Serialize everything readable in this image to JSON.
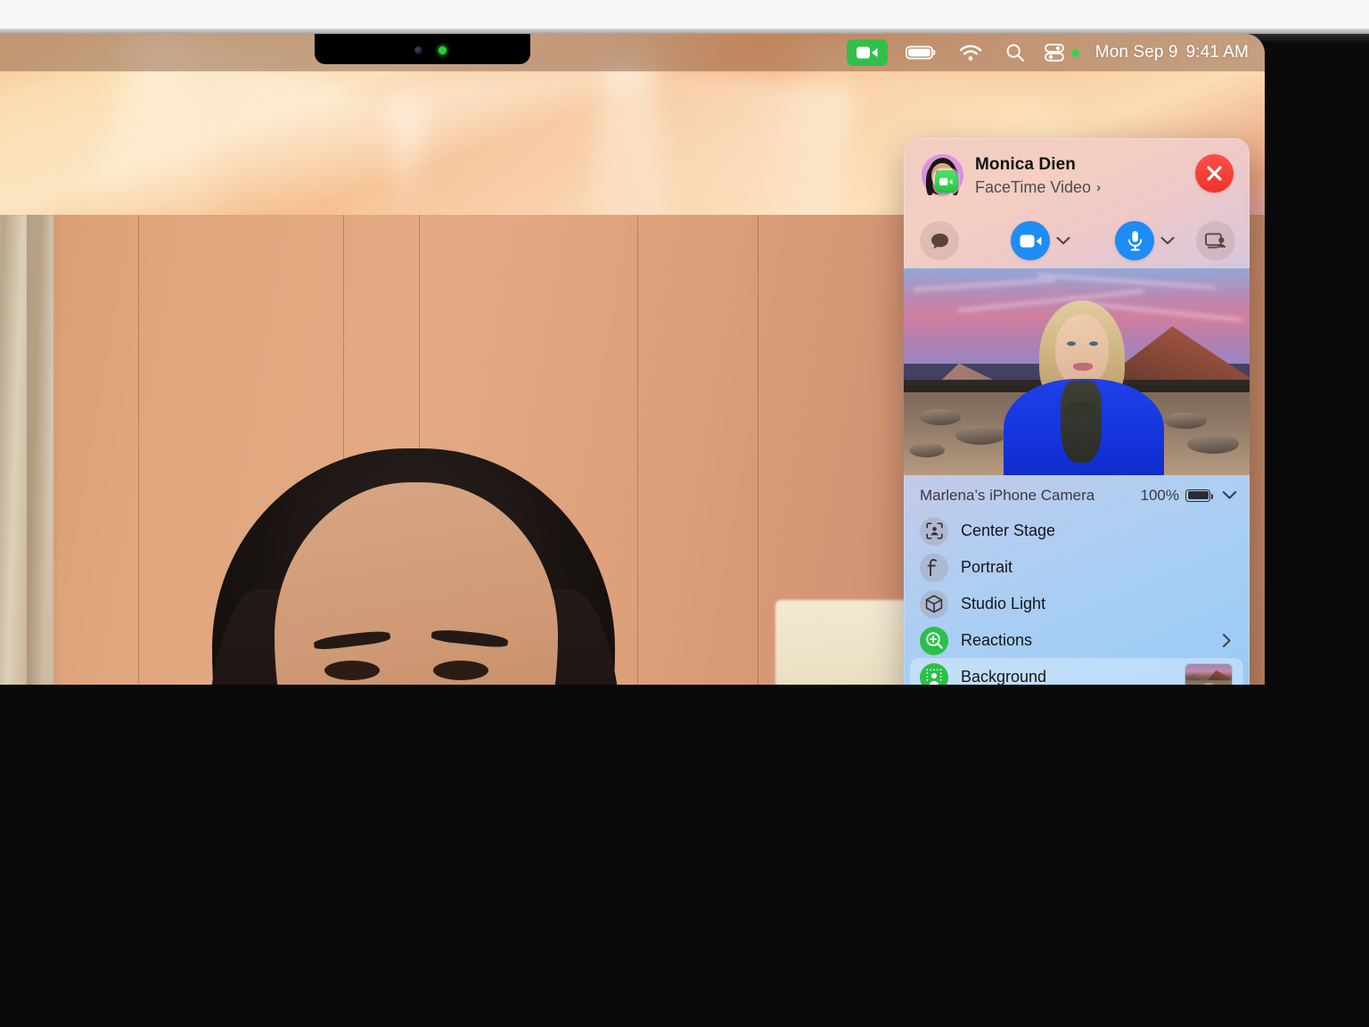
{
  "menubar": {
    "items": [
      {
        "name": "facetime-active-icon",
        "label": "FaceTime"
      },
      {
        "name": "battery-icon",
        "label": "Battery"
      },
      {
        "name": "wifi-icon",
        "label": "Wi-Fi"
      },
      {
        "name": "search-icon",
        "label": "Spotlight Search"
      },
      {
        "name": "control-center-icon",
        "label": "Control Center"
      }
    ],
    "date": "Mon Sep 9",
    "time": "9:41 AM"
  },
  "popup": {
    "caller_name": "Monica Dien",
    "call_type": "FaceTime Video",
    "call_type_chevron": "›",
    "close_label": "End Call",
    "controls": [
      {
        "name": "messages-button",
        "label": "Messages"
      },
      {
        "name": "camera-button",
        "label": "Camera"
      },
      {
        "name": "camera-options-button",
        "label": "Camera Options"
      },
      {
        "name": "microphone-button",
        "label": "Microphone"
      },
      {
        "name": "microphone-options-button",
        "label": "Microphone Options"
      },
      {
        "name": "share-screen-button",
        "label": "Share Screen"
      }
    ],
    "source": {
      "label": "Marlena’s iPhone Camera",
      "battery_percent": "100%",
      "chevron": "⌄"
    },
    "effects": [
      {
        "label": "Center Stage",
        "icon": "center-stage-icon",
        "active": false,
        "tail": "none"
      },
      {
        "label": "Portrait",
        "icon": "portrait-icon",
        "active": false,
        "tail": "none"
      },
      {
        "label": "Studio Light",
        "icon": "studio-light-icon",
        "active": false,
        "tail": "none"
      },
      {
        "label": "Reactions",
        "icon": "reactions-icon",
        "active": true,
        "tail": "chevron",
        "chevron": "›"
      },
      {
        "label": "Background",
        "icon": "background-icon",
        "active": true,
        "tail": "thumbnail",
        "selected": true
      }
    ]
  },
  "colors": {
    "accent_blue": "#1e8cf5",
    "active_green": "#2bc04a",
    "end_call_red": "#f03229",
    "menubar_green": "#30c04a"
  }
}
